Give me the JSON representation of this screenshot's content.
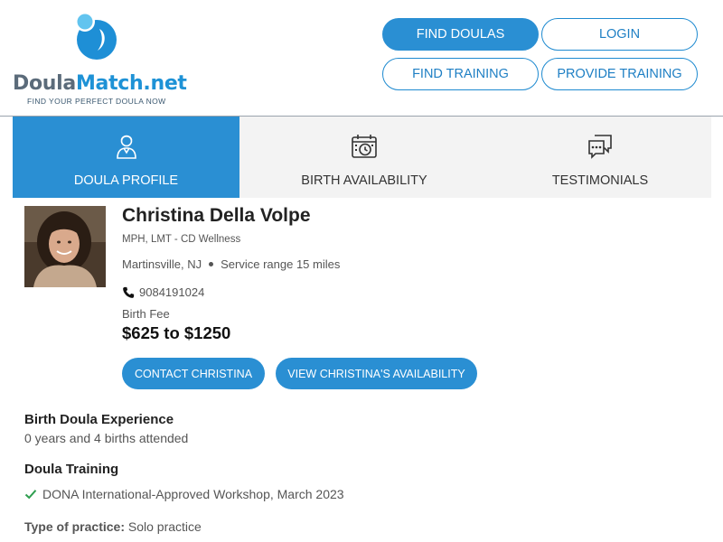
{
  "brand": {
    "name_part1": "Doula",
    "name_part2": "Match.net",
    "tagline": "FIND YOUR PERFECT DOULA NOW",
    "accent_color": "#2a8fd3"
  },
  "nav": {
    "find_doulas": "Find Doulas",
    "login": "Login",
    "find_training": "Find Training",
    "provide_training": "Provide Training"
  },
  "tabs": [
    {
      "label": "Doula Profile",
      "icon": "person-icon",
      "active": true
    },
    {
      "label": "Birth Availability",
      "icon": "calendar-clock-icon",
      "active": false
    },
    {
      "label": "Testimonials",
      "icon": "chat-bubbles-icon",
      "active": false
    }
  ],
  "profile": {
    "name": "Christina Della Volpe",
    "credentials": "MPH, LMT - CD Wellness",
    "location": "Martinsville, NJ",
    "service_range": "Service range 15 miles",
    "phone": "9084191024",
    "fee_label": "Birth Fee",
    "fee": "$625 to $1250",
    "contact_button": "Contact Christina",
    "availability_button": "View Christina's Availability"
  },
  "experience": {
    "heading": "Birth Doula Experience",
    "text": "0 years and 4 births attended"
  },
  "training": {
    "heading": "Doula Training",
    "items": [
      "DONA International-Approved Workshop, March 2023"
    ]
  },
  "practice": {
    "label": "Type of practice:",
    "value": "Solo practice"
  }
}
